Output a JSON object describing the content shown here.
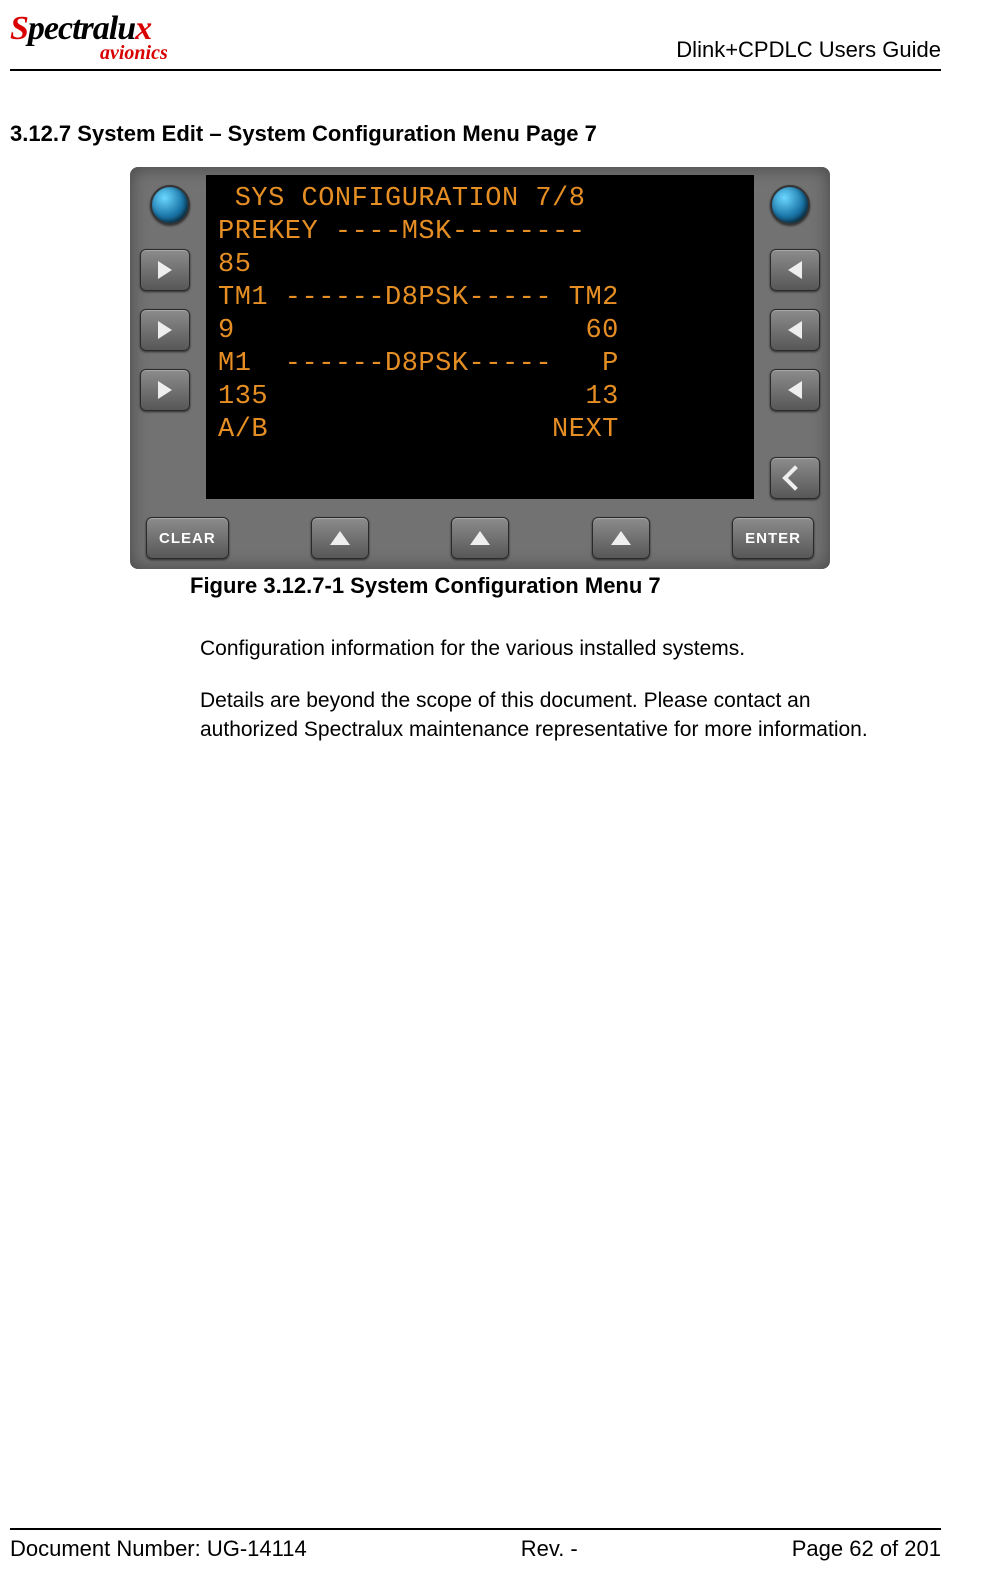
{
  "header": {
    "logo_main": "Spectralux",
    "logo_sub": "avionics",
    "doc_title": "Dlink+CPDLC Users Guide"
  },
  "section": {
    "heading": "3.12.7 System Edit – System Configuration Menu Page 7"
  },
  "screen": {
    "line1": " SYS CONFIGURATION 7/8",
    "line2": "PREKEY ----MSK--------",
    "line3": "85",
    "line4": "TM1 ------D8PSK----- TM2",
    "line5": "9                     60",
    "line6": "M1  ------D8PSK-----   P",
    "line7": "135                   13",
    "line8": "",
    "line9": "A/B                 NEXT"
  },
  "buttons": {
    "clear": "CLEAR",
    "enter": "ENTER"
  },
  "figure": {
    "caption": "Figure 3.12.7-1 System Configuration Menu 7"
  },
  "body": {
    "p1": "Configuration information for the various installed systems.",
    "p2": "Details are beyond the scope of this document.  Please contact an authorized Spectralux maintenance representative for more information."
  },
  "footer": {
    "docnum": "Document Number:  UG-14114",
    "rev": "Rev. -",
    "page": "Page 62 of 201"
  }
}
